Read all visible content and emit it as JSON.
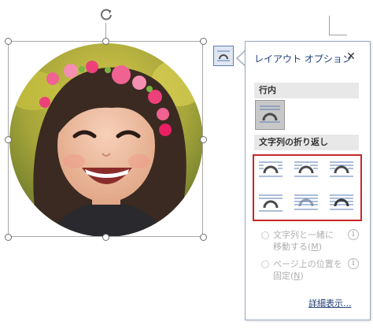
{
  "image": {
    "description_icon": "photo-circle-cropped",
    "selection_color": "#a8a8a8"
  },
  "layout_button": {
    "icon": "layout-options-icon"
  },
  "panel": {
    "title": "レイアウト オプション",
    "close_label": "✕",
    "sections": [
      {
        "title": "行内"
      },
      {
        "title": "文字列の折り返し"
      }
    ],
    "move_with_text": {
      "label_line1": "文字列と一緒に",
      "label_line2": "移動する(",
      "key": "M",
      "suffix": ")"
    },
    "fix_position": {
      "label_line1": "ページ上の位置を",
      "label_line2": "固定(",
      "key": "N",
      "suffix": ")"
    },
    "info_glyph": "i",
    "more_link": "詳細表示..."
  },
  "colors": {
    "accent": "#1f3f77",
    "highlight_border": "#c62828"
  }
}
